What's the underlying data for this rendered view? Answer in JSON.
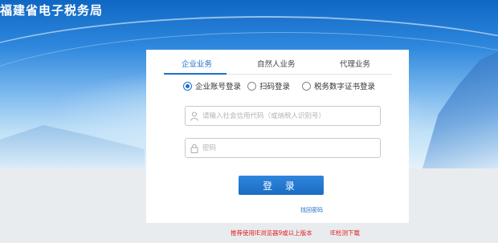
{
  "header": {
    "title": "福建省电子税务局"
  },
  "login": {
    "tabs": [
      {
        "label": "企业业务",
        "active": true
      },
      {
        "label": "自然人业务",
        "active": false
      },
      {
        "label": "代理业务",
        "active": false
      }
    ],
    "modes": [
      {
        "label": "企业账号登录",
        "checked": true
      },
      {
        "label": "扫码登录",
        "checked": false
      },
      {
        "label": "税务数字证书登录",
        "checked": false
      }
    ],
    "account_placeholder": "请输入社会信用代码（或纳税人识别号）",
    "account_value": "",
    "password_placeholder": "密码",
    "password_value": "",
    "login_button": "登 录",
    "forgot_password": "找回密码"
  },
  "footer": {
    "recommend_text": "推荐使用IE浏览器9或以上版本",
    "ie_check_link": "IE检测下载"
  },
  "colors": {
    "accent": "#1f6fc9",
    "header_blue": "#0f67c4",
    "warning": "#e02020"
  }
}
